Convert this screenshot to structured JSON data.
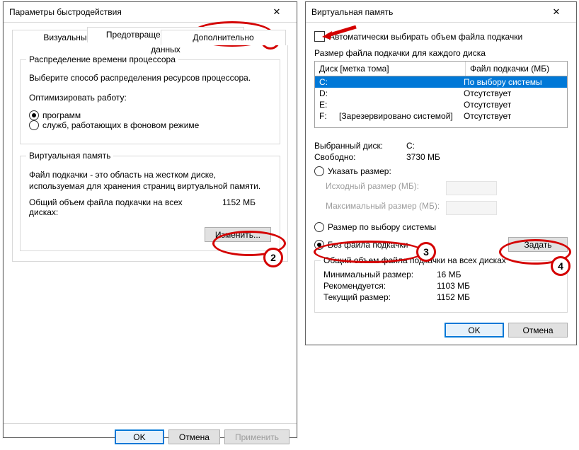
{
  "perf": {
    "title": "Параметры быстродействия",
    "tabs": {
      "dep": "Предотвращение выполнения данных",
      "visual": "Визуальные эффекты",
      "advanced": "Дополнительно"
    },
    "sched": {
      "legend": "Распределение времени процессора",
      "desc": "Выберите способ распределения ресурсов процессора.",
      "optLabel": "Оптимизировать работу:",
      "programs": "программ",
      "services": "служб, работающих в фоновом режиме"
    },
    "vm": {
      "legend": "Виртуальная память",
      "desc": "Файл подкачки - это область на жестком диске, используемая для хранения страниц виртуальной памяти.",
      "totalLabel": "Общий объем файла подкачки на всех дисках:",
      "totalValue": "1152 МБ",
      "change": "Изменить..."
    },
    "ok": "OK",
    "cancel": "Отмена",
    "apply": "Применить"
  },
  "vmd": {
    "title": "Виртуальная память",
    "auto": "Автоматически выбирать объем файла подкачки",
    "listLabel": "Размер файла подкачки для каждого диска",
    "colDrive": "Диск [метка тома]",
    "colPf": "Файл подкачки (МБ)",
    "drives": [
      {
        "l": "C:",
        "m": "",
        "pf": "По выбору системы",
        "sel": true
      },
      {
        "l": "D:",
        "m": "",
        "pf": "Отсутствует"
      },
      {
        "l": "E:",
        "m": "",
        "pf": "Отсутствует"
      },
      {
        "l": "F:",
        "m": "[Зарезервировано системой]",
        "pf": "Отсутствует"
      }
    ],
    "selDriveLabel": "Выбранный диск:",
    "selDrive": "C:",
    "freeLabel": "Свободно:",
    "free": "3730 МБ",
    "custom": "Указать размер:",
    "initLabel": "Исходный размер (МБ):",
    "maxLabel": "Максимальный размер (МБ):",
    "system": "Размер по выбору системы",
    "none": "Без файла подкачки",
    "set": "Задать",
    "totals": {
      "legend": "Общий объем файла подкачки на всех дисках",
      "minL": "Минимальный размер:",
      "min": "16 МБ",
      "recL": "Рекомендуется:",
      "rec": "1103 МБ",
      "curL": "Текущий размер:",
      "cur": "1152 МБ"
    },
    "ok": "OK",
    "cancel": "Отмена"
  }
}
